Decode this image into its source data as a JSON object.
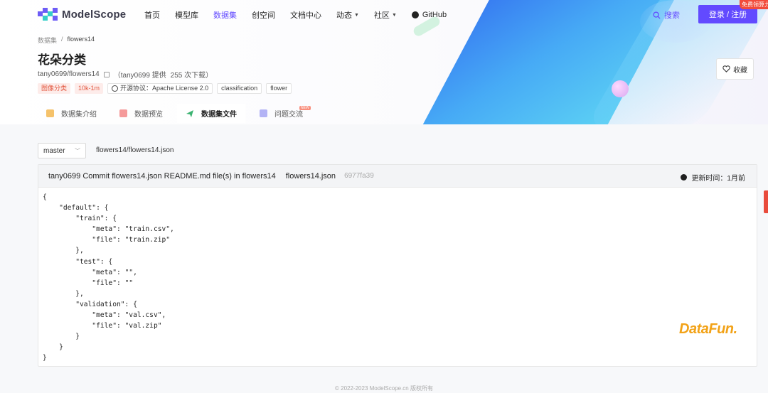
{
  "nav": {
    "logo_text": "ModelScope",
    "items": [
      {
        "label": "首页"
      },
      {
        "label": "模型库"
      },
      {
        "label": "数据集"
      },
      {
        "label": "创空间"
      },
      {
        "label": "文档中心"
      },
      {
        "label": "动态"
      },
      {
        "label": "社区"
      },
      {
        "label": "GitHub"
      }
    ],
    "search_label": "搜索",
    "login_label": "登录 / 注册",
    "promo_label": "免费领算力"
  },
  "breadcrumb": {
    "root": "数据集",
    "sep": "/",
    "current": "flowers14"
  },
  "dataset": {
    "title": "花朵分类",
    "repo": "tany0699/flowers14",
    "provider": "（tany0699 提供",
    "downloads": "255 次下载）",
    "tags": {
      "category": "图像分类",
      "size": "10k-1m",
      "license": "开源协议：Apache License 2.0",
      "tag1": "classification",
      "tag2": "flower"
    },
    "favorite_label": "收藏"
  },
  "tabs": {
    "intro": "数据集介绍",
    "preview": "数据预览",
    "files": "数据集文件",
    "issues": "问题交流",
    "new_badge": "NEW"
  },
  "files": {
    "branch": "master",
    "path": "flowers14/flowers14.json",
    "commit": {
      "message": "tany0699 Commit flowers14.json README.md file(s) in flowers14",
      "file": "flowers14.json",
      "hash": "6977fa39",
      "updated": "更新时间：1月前"
    },
    "content": "{\n    \"default\": {\n        \"train\": {\n            \"meta\": \"train.csv\",\n            \"file\": \"train.zip\"\n        },\n        \"test\": {\n            \"meta\": \"\",\n            \"file\": \"\"\n        },\n        \"validation\": {\n            \"meta\": \"val.csv\",\n            \"file\": \"val.zip\"\n        }\n    }\n}"
  },
  "watermark": "DataFun.",
  "footer": "© 2022-2023 ModelScope.cn 版权所有",
  "colors": {
    "accent": "#624aff",
    "tag_red": "#e2563e",
    "watermark": "#f2a217"
  }
}
